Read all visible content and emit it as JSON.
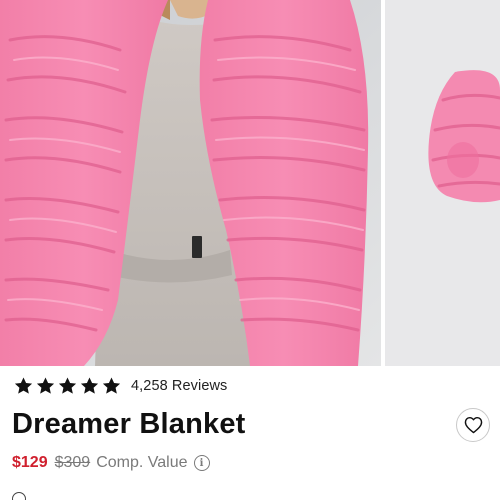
{
  "product": {
    "title": "Dreamer Blanket",
    "color": "pink",
    "images": [
      {
        "name": "model-wearing-pink-blanket"
      },
      {
        "name": "rolled-pink-blanket"
      }
    ]
  },
  "reviews": {
    "rating": 5,
    "max_rating": 5,
    "count_label": "4,258 Reviews"
  },
  "pricing": {
    "price": "$129",
    "compare_price": "$309",
    "compare_label": "Comp. Value",
    "price_color": "#d0202e"
  },
  "icons": {
    "star": "star-icon",
    "wishlist": "heart-outline-icon",
    "info": "info-circle-icon"
  }
}
